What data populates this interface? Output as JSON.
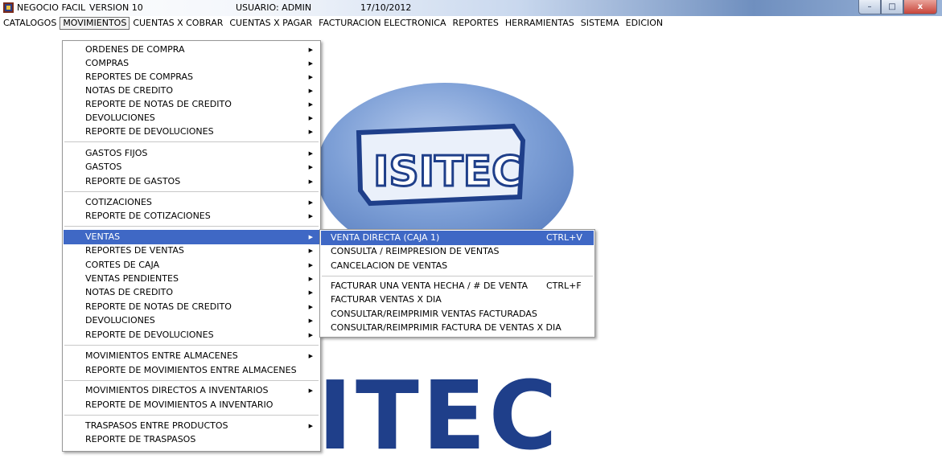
{
  "window": {
    "app_name": "NEGOCIO FACIL",
    "version": "VERSION 10",
    "user": "USUARIO: ADMIN",
    "date": "17/10/2012",
    "controls": {
      "minimize": "–",
      "maximize": "□",
      "close": "x"
    }
  },
  "menubar": {
    "items": [
      "CATALOGOS",
      "MOVIMIENTOS",
      "CUENTAS X COBRAR",
      "CUENTAS X PAGAR",
      "FACTURACION ELECTRONICA",
      "REPORTES",
      "HERRAMIENTAS",
      "SISTEMA",
      "EDICION"
    ],
    "active": "MOVIMIENTOS"
  },
  "movimientos_menu": {
    "items": [
      {
        "label": "ORDENES DE COMPRA",
        "submenu": true
      },
      {
        "label": "COMPRAS",
        "submenu": true
      },
      {
        "label": "REPORTES DE COMPRAS",
        "submenu": true
      },
      {
        "label": "NOTAS DE CREDITO",
        "submenu": true
      },
      {
        "label": "REPORTE DE NOTAS DE CREDITO",
        "submenu": true
      },
      {
        "label": "DEVOLUCIONES",
        "submenu": true
      },
      {
        "label": "REPORTE DE DEVOLUCIONES",
        "submenu": true
      },
      {
        "label": "GASTOS FIJOS",
        "submenu": true
      },
      {
        "label": "GASTOS",
        "submenu": true
      },
      {
        "label": "REPORTE DE GASTOS",
        "submenu": true
      },
      {
        "label": "COTIZACIONES",
        "submenu": true
      },
      {
        "label": "REPORTE DE COTIZACIONES",
        "submenu": true
      },
      {
        "label": "VENTAS",
        "submenu": true,
        "highlighted": true
      },
      {
        "label": "REPORTES DE VENTAS",
        "submenu": true
      },
      {
        "label": "CORTES DE CAJA",
        "submenu": true
      },
      {
        "label": "VENTAS PENDIENTES",
        "submenu": true
      },
      {
        "label": "NOTAS DE CREDITO",
        "submenu": true
      },
      {
        "label": "REPORTE DE NOTAS DE CREDITO",
        "submenu": true
      },
      {
        "label": "DEVOLUCIONES",
        "submenu": true
      },
      {
        "label": "REPORTE DE DEVOLUCIONES",
        "submenu": true
      },
      {
        "label": "MOVIMIENTOS ENTRE ALMACENES",
        "submenu": true
      },
      {
        "label": "REPORTE DE MOVIMIENTOS ENTRE ALMACENES",
        "submenu": false
      },
      {
        "label": "MOVIMIENTOS DIRECTOS A INVENTARIOS",
        "submenu": true
      },
      {
        "label": "REPORTE DE MOVIMIENTOS A INVENTARIO",
        "submenu": false
      },
      {
        "label": "TRASPASOS ENTRE PRODUCTOS",
        "submenu": true
      },
      {
        "label": "REPORTE DE TRASPASOS",
        "submenu": false
      }
    ]
  },
  "ventas_submenu": {
    "items": [
      {
        "label": "VENTA DIRECTA (CAJA 1)",
        "shortcut": "CTRL+V",
        "highlighted": true
      },
      {
        "label": "CONSULTA / REIMPRESION DE VENTAS",
        "shortcut": ""
      },
      {
        "label": "CANCELACION DE VENTAS",
        "shortcut": ""
      },
      {
        "label": "FACTURAR UNA VENTA HECHA / # DE VENTA",
        "shortcut": "CTRL+F"
      },
      {
        "label": "FACTURAR VENTAS X DIA",
        "shortcut": ""
      },
      {
        "label": "CONSULTAR/REIMPRIMIR  VENTAS FACTURADAS",
        "shortcut": ""
      },
      {
        "label": "CONSULTAR/REIMPRIMIR FACTURA DE VENTAS X DIA",
        "shortcut": ""
      }
    ]
  },
  "background": {
    "logo_text": "ISITEC",
    "big_text": "ITEC"
  },
  "colors": {
    "highlight": "#3f68c5",
    "logo_blue": "#1f3f8a",
    "logo_light": "#7d9fd6"
  }
}
